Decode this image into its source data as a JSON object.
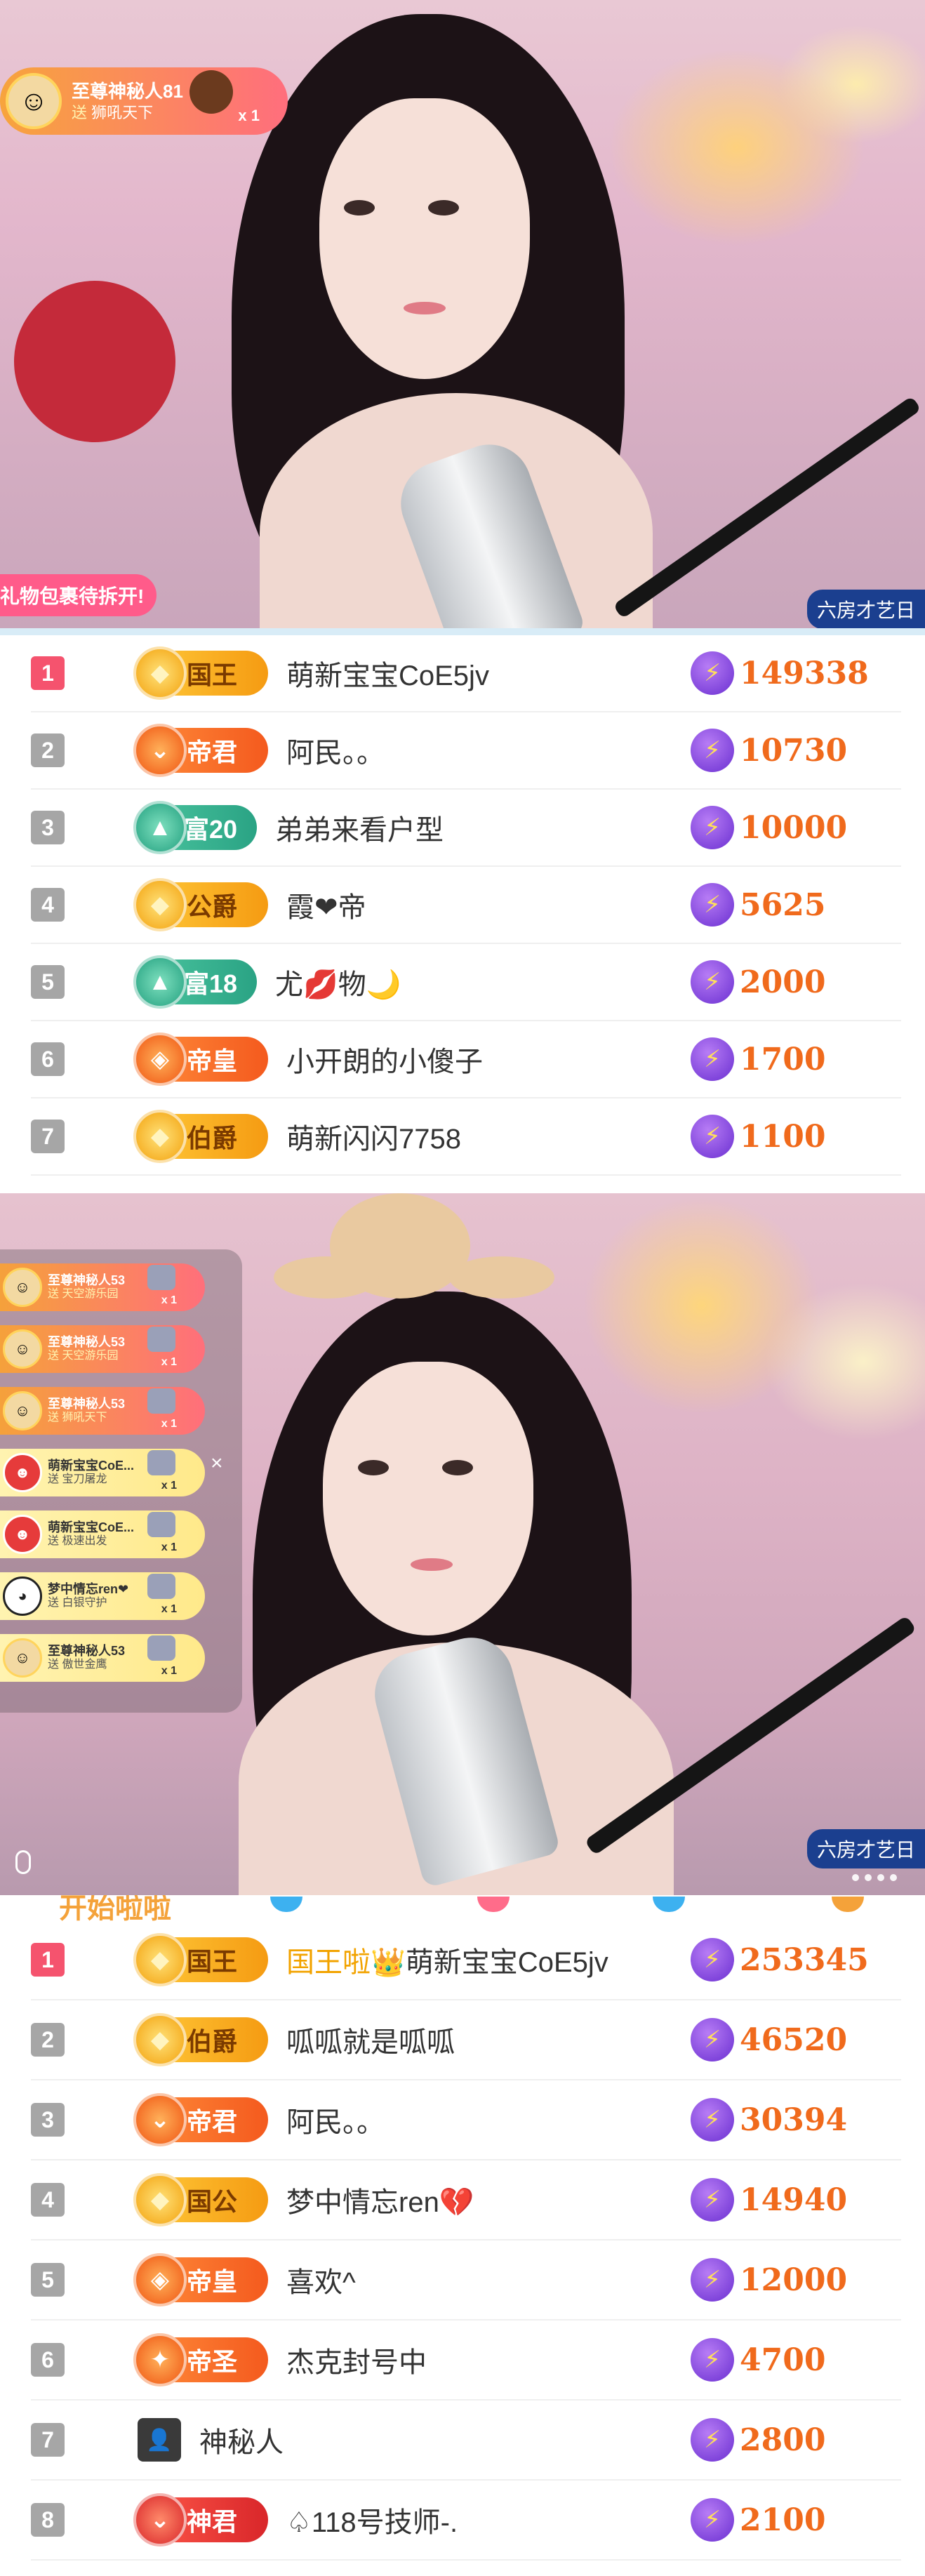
{
  "stream1": {
    "top_gift": {
      "name": "至尊神秘人81",
      "action": "送",
      "gift": "狮吼天下",
      "count": "x 1"
    },
    "gift_opening_text": "礼物包裹待拆开!",
    "room_tag": "六房才艺日"
  },
  "ranking1": [
    {
      "rank": "1",
      "badge": "国王",
      "badge_style": "gold",
      "emblem": "◆",
      "name": "萌新宝宝CoE5jv",
      "score": "149338"
    },
    {
      "rank": "2",
      "badge": "帝君",
      "badge_style": "orange",
      "emblem": "⌄",
      "name": "阿民。。",
      "score": "10730"
    },
    {
      "rank": "3",
      "badge": "富20",
      "badge_style": "green",
      "emblem": "▲",
      "name": "弟弟来看户型",
      "score": "10000"
    },
    {
      "rank": "4",
      "badge": "公爵",
      "badge_style": "gold",
      "emblem": "◆",
      "name": "霞❤帝",
      "score": "5625"
    },
    {
      "rank": "5",
      "badge": "富18",
      "badge_style": "green",
      "emblem": "▲",
      "name": "尤💋物🌙",
      "score": "2000"
    },
    {
      "rank": "6",
      "badge": "帝皇",
      "badge_style": "orange",
      "emblem": "◈",
      "name": "小开朗的小傻子",
      "score": "1700"
    },
    {
      "rank": "7",
      "badge": "伯爵",
      "badge_style": "gold",
      "emblem": "◆",
      "name": "萌新闪闪7758",
      "score": "1100"
    }
  ],
  "stream2": {
    "gifts": [
      {
        "name": "至尊神秘人53",
        "action": "送",
        "gift": "天空游乐园",
        "count": "x 1",
        "style": "gold",
        "avatar": "☺"
      },
      {
        "name": "至尊神秘人53",
        "action": "送",
        "gift": "天空游乐园",
        "count": "x 1",
        "style": "gold",
        "avatar": "☺"
      },
      {
        "name": "至尊神秘人53",
        "action": "送",
        "gift": "狮吼天下",
        "count": "x 1",
        "style": "gold",
        "avatar": "☺"
      },
      {
        "name": "萌新宝宝CoE...",
        "action": "送",
        "gift": "宝刀屠龙",
        "count": "x 1",
        "style": "pale",
        "avatar": "☻"
      },
      {
        "name": "萌新宝宝CoE...",
        "action": "送",
        "gift": "极速出发",
        "count": "x 1",
        "style": "pale",
        "avatar": "☻"
      },
      {
        "name": "梦中情忘ren❤",
        "action": "送",
        "gift": "白银守护",
        "count": "x 1",
        "style": "pale",
        "avatar": "◕"
      },
      {
        "name": "至尊神秘人53",
        "action": "送",
        "gift": "傲世金鹰",
        "count": "x 1",
        "style": "pale",
        "avatar": "☺"
      }
    ],
    "close_icon": "×",
    "room_tag": "六房才艺日"
  },
  "ranking2_header": "开始啦啦",
  "ranking2": [
    {
      "rank": "1",
      "badge": "国王",
      "badge_style": "gold",
      "emblem": "◆",
      "prefix": "国王啦👑",
      "name": "萌新宝宝CoE5jv",
      "score": "253345"
    },
    {
      "rank": "2",
      "badge": "伯爵",
      "badge_style": "gold",
      "emblem": "◆",
      "prefix": "",
      "name": "呱呱就是呱呱",
      "score": "46520"
    },
    {
      "rank": "3",
      "badge": "帝君",
      "badge_style": "orange",
      "emblem": "⌄",
      "prefix": "",
      "name": "阿民。。",
      "score": "30394"
    },
    {
      "rank": "4",
      "badge": "国公",
      "badge_style": "gold",
      "emblem": "◆",
      "prefix": "",
      "name": "梦中情忘ren💔",
      "score": "14940"
    },
    {
      "rank": "5",
      "badge": "帝皇",
      "badge_style": "orange",
      "emblem": "◈",
      "prefix": "",
      "name": "喜欢^",
      "score": "12000"
    },
    {
      "rank": "6",
      "badge": "帝圣",
      "badge_style": "orange",
      "emblem": "✦",
      "prefix": "",
      "name": "杰克封号中",
      "score": "4700"
    },
    {
      "rank": "7",
      "badge": "",
      "badge_style": "mystery",
      "emblem": "👤",
      "prefix": "",
      "name": "神秘人",
      "score": "2800"
    },
    {
      "rank": "8",
      "badge": "神君",
      "badge_style": "red",
      "emblem": "⌄",
      "prefix": "",
      "name": "♤118号技师-.",
      "score": "2100"
    }
  ]
}
